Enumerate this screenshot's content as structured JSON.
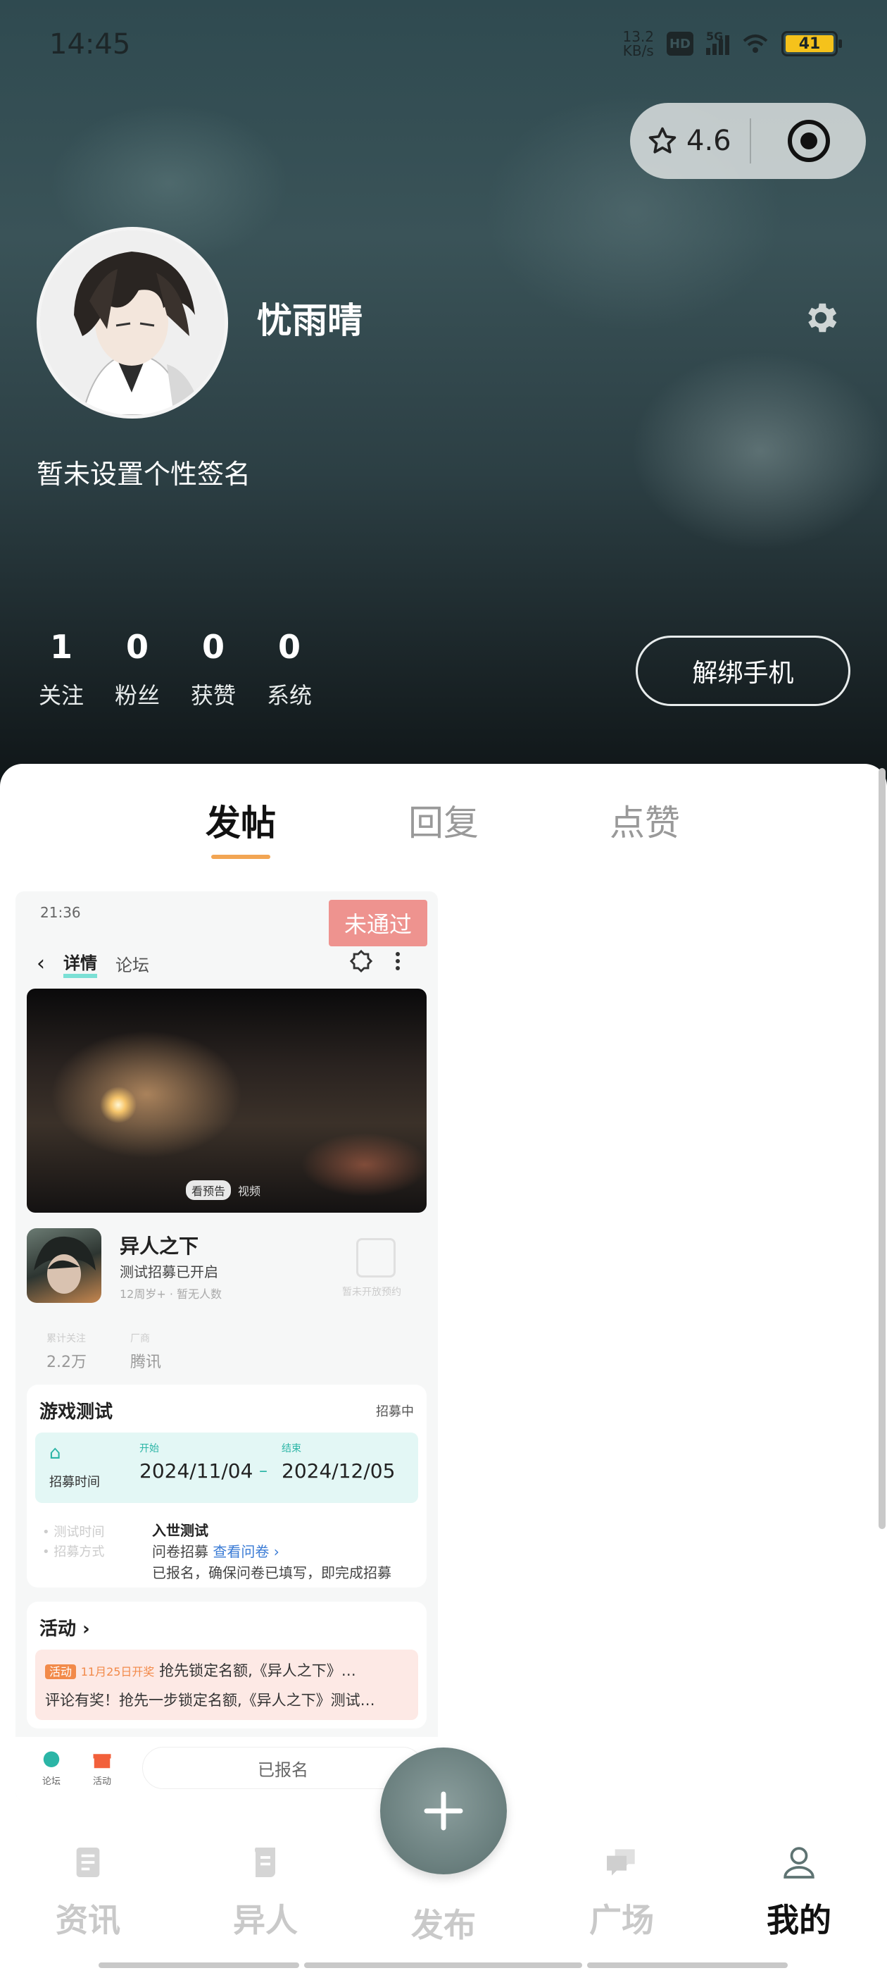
{
  "status_bar": {
    "time": "14:45",
    "net_speed_value": "13.2",
    "net_speed_unit": "KB/s",
    "hd": "HD",
    "signal": "5G",
    "battery": "41"
  },
  "capsule": {
    "rating": "4.6"
  },
  "profile": {
    "username": "忧雨晴",
    "signature": "暂未设置个性签名"
  },
  "stats": [
    {
      "value": "1",
      "label": "关注"
    },
    {
      "value": "0",
      "label": "粉丝"
    },
    {
      "value": "0",
      "label": "获赞"
    },
    {
      "value": "0",
      "label": "系统"
    }
  ],
  "unbind_button": "解绑手机",
  "tabs": [
    {
      "label": "发帖",
      "active": true
    },
    {
      "label": "回复",
      "active": false
    },
    {
      "label": "点赞",
      "active": false
    }
  ],
  "post": {
    "status_badge": "未通过",
    "screenshot": {
      "time": "21:36",
      "nav_title": "详情",
      "nav_sub": "论坛",
      "video_pill": "看预告",
      "video_label": "视频",
      "game_name": "异人之下",
      "game_sub": "测试招募已开启",
      "game_meta": "12周岁+ · 暂无人数",
      "preorder_label": "暂未开放预约",
      "stat1_label": "累计关注",
      "stat1_value": "2.2万",
      "stat2_label": "厂商",
      "stat2_value": "腾讯",
      "test_title": "游戏测试",
      "test_status": "招募中",
      "test_range_label": "招募时间",
      "start_key": "开始",
      "start_date": "2024/11/04",
      "end_key": "结束",
      "end_date": "2024/12/05",
      "step1": "• 测试时间",
      "step2": "• 招募方式",
      "detail_line1": "入世测试",
      "detail_line2_a": "问卷招募",
      "detail_line2_link": "查看问卷 ›",
      "detail_line3": "已报名，确保问卷已填写，即完成招募",
      "activity_title": "活动 ›",
      "activity_tag": "活动",
      "activity_tag_note": "11月25日开奖",
      "activity_line1": "抢先锁定名额,《异人之下》…",
      "activity_line2": "评论有奖！抢先一步锁定名额,《异人之下》测试…",
      "bottom_icon1": "论坛",
      "bottom_icon2": "活动",
      "joined_button": "已报名"
    }
  },
  "bottom_nav": [
    {
      "label": "资讯",
      "icon": "news-icon",
      "active": false
    },
    {
      "label": "异人",
      "icon": "scroll-icon",
      "active": false
    },
    {
      "label": "发布",
      "icon": "plus-icon",
      "active": false
    },
    {
      "label": "广场",
      "icon": "chat-bubbles-icon",
      "active": false
    },
    {
      "label": "我的",
      "icon": "person-icon",
      "active": true
    }
  ],
  "colors": {
    "tab_underline": "#f2a553",
    "fail_badge": "#ee8e8a",
    "battery": "#f5c21b"
  }
}
